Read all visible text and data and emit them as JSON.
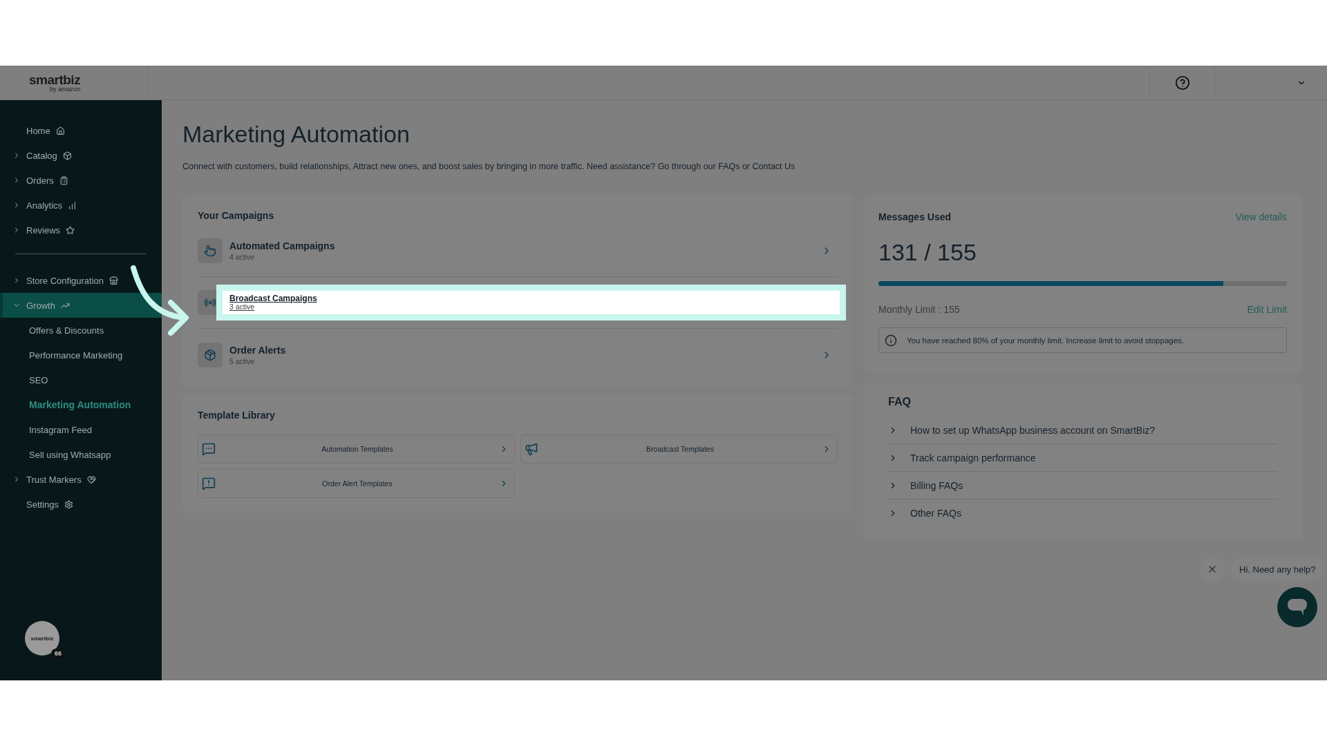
{
  "header": {
    "logo": "smartbiz",
    "logo_sub": "by amazon"
  },
  "sidebar": {
    "items": [
      {
        "kind": "link",
        "label": "Home"
      },
      {
        "kind": "group",
        "label": "Catalog",
        "expanded": false
      },
      {
        "kind": "group",
        "label": "Orders",
        "expanded": false
      },
      {
        "kind": "group",
        "label": "Analytics",
        "expanded": false
      },
      {
        "kind": "group",
        "label": "Reviews",
        "expanded": false
      },
      {
        "kind": "divider"
      },
      {
        "kind": "group",
        "label": "Store Configuration",
        "expanded": false
      },
      {
        "kind": "group",
        "label": "Growth",
        "expanded": true,
        "selected": true,
        "children": [
          {
            "label": "Offers & Discounts",
            "selected": false
          },
          {
            "label": "Performance Marketing",
            "selected": false
          },
          {
            "label": "SEO",
            "selected": false
          },
          {
            "label": "Marketing Automation",
            "selected": true
          },
          {
            "label": "Instagram Feed",
            "selected": false
          },
          {
            "label": "Sell using Whatsapp",
            "selected": false
          }
        ]
      },
      {
        "kind": "group",
        "label": "Trust Markers",
        "expanded": false
      },
      {
        "kind": "link",
        "label": "Settings"
      }
    ],
    "avatar": {
      "label": "smartbiz",
      "badge": "66"
    }
  },
  "page": {
    "title": "Marketing Automation",
    "description": "Connect with customers, build relationships, Attract new ones, and boost sales by bringing in more traffic. Need assistance? Go through our FAQs or Contact Us"
  },
  "campaigns": {
    "title": "Your Campaigns",
    "rows": [
      {
        "title": "Automated Campaigns",
        "count": "4 active",
        "highlighted": false
      },
      {
        "title": "Broadcast Campaigns",
        "count": "3 active",
        "highlighted": true
      },
      {
        "title": "Order Alerts",
        "count": "5 active",
        "highlighted": false
      }
    ]
  },
  "messages": {
    "title": "Messages Used",
    "link": "View details",
    "value": "131 / 155",
    "level": 0.845,
    "limit": "Monthly Limit : 155",
    "edit": "Edit Limit",
    "notice": "You have reached 80% of your monthly limit. Increase limit to avoid stoppages."
  },
  "templates": {
    "title": "Template Library",
    "items": [
      "Automation Templates",
      "Broadcast Templates",
      "Order Alert Templates"
    ]
  },
  "faq": {
    "title": "FAQ",
    "items": [
      "How to set up WhatsApp business account on SmartBiz?",
      "Track campaign performance",
      "Billing FAQs",
      "Other FAQs"
    ]
  },
  "chat": {
    "greeting": "Hi. Need any help?"
  }
}
